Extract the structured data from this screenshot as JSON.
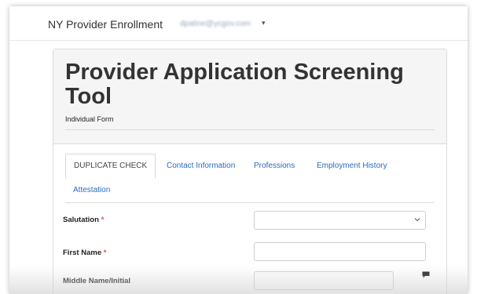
{
  "navbar": {
    "brand": "NY Provider Enrollment",
    "user_email": "dpatine@ycgov.com",
    "menu_caret": "▾"
  },
  "header": {
    "title": "Provider Application Screening Tool",
    "subtitle": "Individual Form"
  },
  "tabs": [
    {
      "label": "DUPLICATE CHECK",
      "active": true
    },
    {
      "label": "Contact Information",
      "active": false
    },
    {
      "label": "Professions",
      "active": false
    },
    {
      "label": "Employment History",
      "active": false
    },
    {
      "label": "Attestation",
      "active": false
    }
  ],
  "form": {
    "salutation": {
      "label": "Salutation",
      "required_mark": "*",
      "value": ""
    },
    "first_name": {
      "label": "First Name",
      "required_mark": "*",
      "value": ""
    },
    "middle_name": {
      "label": "Middle Name/Initial",
      "value": ""
    }
  },
  "icons": {
    "select": "chevron-down-icon",
    "comment": "comment-icon"
  },
  "colors": {
    "link": "#2a6cc0",
    "required": "#d9534f",
    "header_bg": "#f5f5f5"
  }
}
